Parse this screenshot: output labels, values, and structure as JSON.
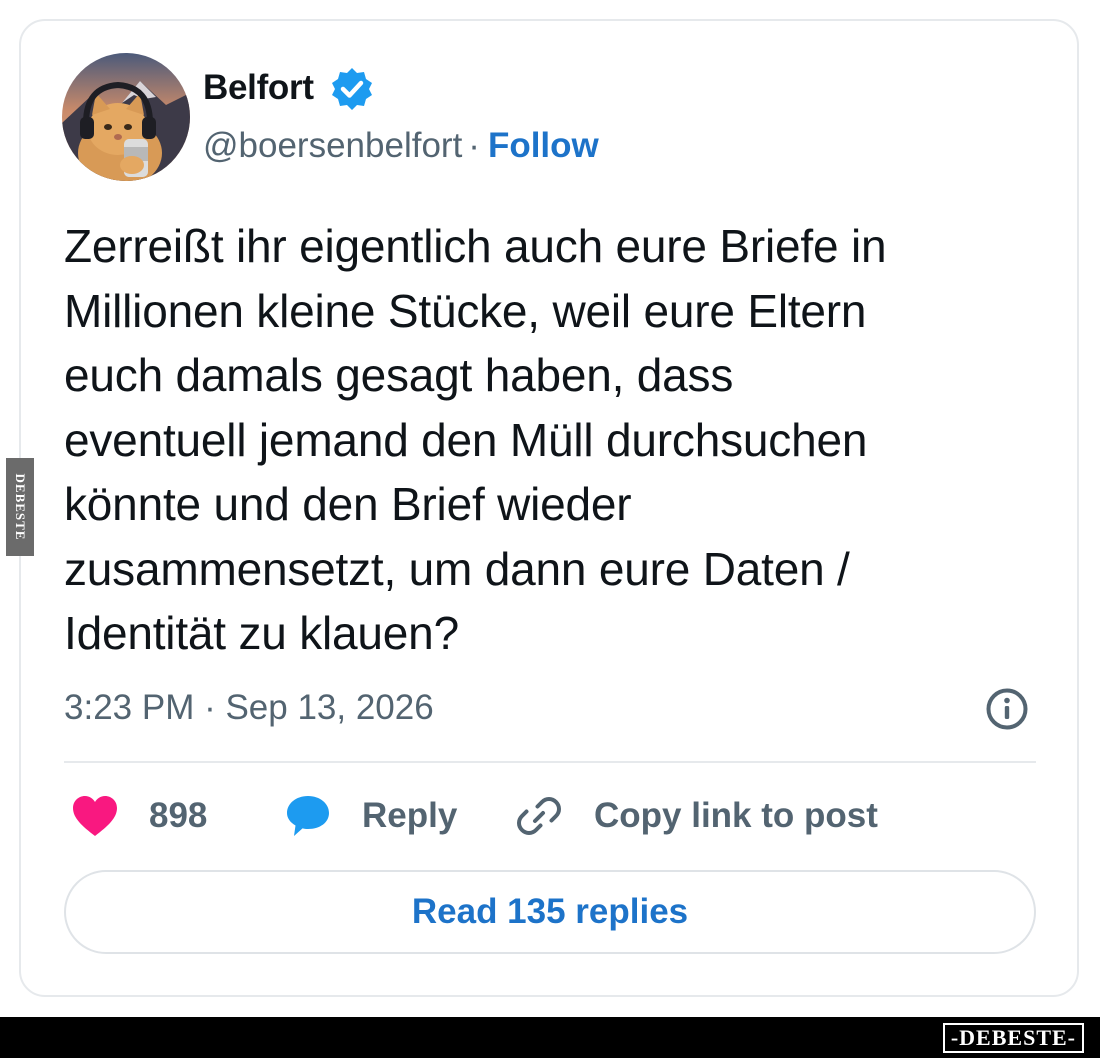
{
  "author": {
    "display_name": "Belfort",
    "verified": true,
    "handle": "@boersenbelfort",
    "separator": "·",
    "follow_label": "Follow"
  },
  "tweet": {
    "text_lines": [
      "Zerreißt ihr eigentlich auch eure Briefe in",
      "Millionen kleine Stücke, weil eure Eltern",
      "euch damals gesagt haben, dass",
      "eventuell jemand den Müll durchsuchen",
      "könnte und den Brief wieder",
      "zusammensetzt, um dann eure Daten /",
      "Identität zu klauen?"
    ],
    "timestamp": "3:23 PM · Sep 13, 2026"
  },
  "actions": {
    "like_count": "898",
    "reply_label": "Reply",
    "copy_link_label": "Copy link to post"
  },
  "read_replies_label": "Read 135 replies",
  "watermark": {
    "side_text": "DEBESTE",
    "brand_text": "-DEBESTE-"
  },
  "colors": {
    "accent_blue": "#1d73c9",
    "like_pink": "#f91880",
    "reply_blue": "#1d9bf0",
    "muted_text": "#536471",
    "main_text": "#0f1419"
  },
  "icons": {
    "verified": "verified-badge-icon",
    "info": "info-icon",
    "like": "heart-icon",
    "reply": "speech-bubble-icon",
    "copy_link": "link-icon"
  }
}
